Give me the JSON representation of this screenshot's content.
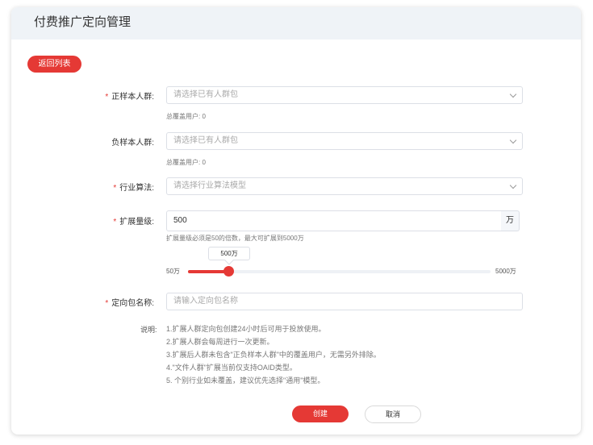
{
  "page": {
    "title": "付费推广定向管理"
  },
  "actions": {
    "back_label": "返回列表",
    "create_label": "创建",
    "cancel_label": "取消"
  },
  "fields": {
    "positive": {
      "label": "正样本人群:",
      "placeholder": "请选择已有人群包",
      "coverage": "总覆盖用户: 0"
    },
    "negative": {
      "label": "负样本人群:",
      "placeholder": "请选择已有人群包",
      "coverage": "总覆盖用户: 0"
    },
    "algorithm": {
      "label": "行业算法:",
      "placeholder": "请选择行业算法模型"
    },
    "expand": {
      "label": "扩展量级:",
      "value": "500",
      "unit": "万",
      "hint": "扩展量级必须是50的倍数，最大可扩展到5000万"
    },
    "name": {
      "label": "定向包名称:",
      "placeholder": "请输入定向包名称"
    }
  },
  "slider": {
    "min_label": "50万",
    "max_label": "5000万",
    "tooltip": "500万",
    "min": 50,
    "max": 5000,
    "value": 500
  },
  "notes": {
    "label": "说明:",
    "items": [
      "1.扩展人群定向包创建24小时后可用于投放使用。",
      "2.扩展人群会每周进行一次更新。",
      "3.扩展后人群未包含\"正负样本人群\"中的覆盖用户，无需另外排除。",
      "4.\"文件人群\"扩展当前仅支持OAID类型。",
      "5. 个别行业如未覆盖，建议优先选择\"通用\"模型。"
    ]
  },
  "colors": {
    "accent": "#e53935",
    "header_bg": "#eff3f7"
  }
}
